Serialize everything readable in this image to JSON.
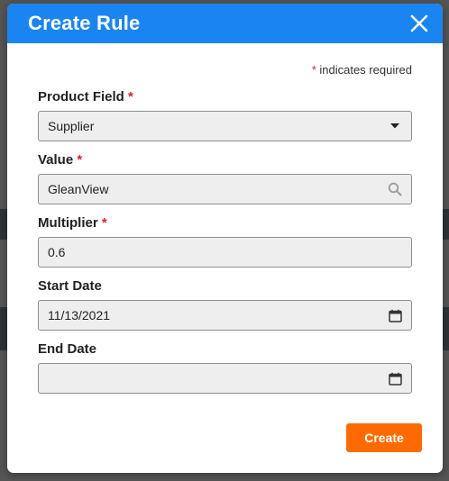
{
  "dialog": {
    "title": "Create Rule",
    "required_note": {
      "star": "*",
      "text": "indicates required"
    }
  },
  "fields": {
    "product_field": {
      "label": "Product Field",
      "required_star": "*",
      "value": "Supplier",
      "icon": "caret-down-icon"
    },
    "value": {
      "label": "Value",
      "required_star": "*",
      "value": "GleanView",
      "icon": "search-icon"
    },
    "multiplier": {
      "label": "Multiplier",
      "required_star": "*",
      "value": "0.6"
    },
    "start_date": {
      "label": "Start Date",
      "value": "11/13/2021",
      "icon": "calendar-icon"
    },
    "end_date": {
      "label": "End Date",
      "value": "",
      "icon": "calendar-icon"
    }
  },
  "actions": {
    "create_label": "Create"
  },
  "colors": {
    "header": "#1a85f0",
    "primary_button": "#ff6a00",
    "required": "#e02020"
  }
}
